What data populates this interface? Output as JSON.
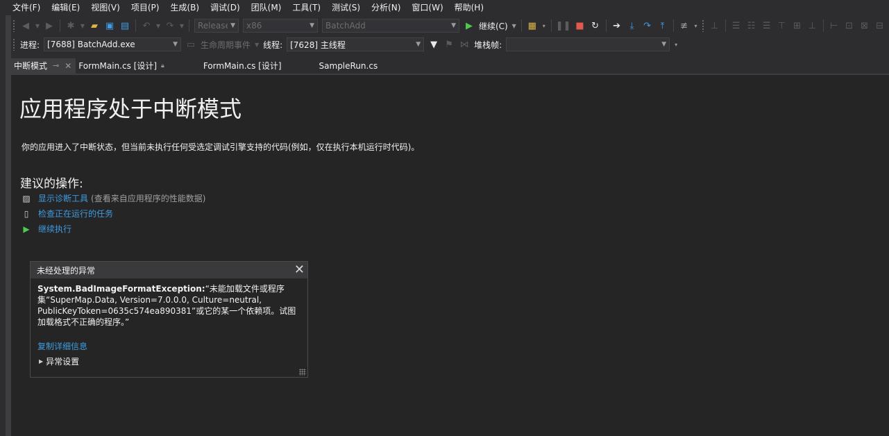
{
  "menu": [
    "文件(F)",
    "编辑(E)",
    "视图(V)",
    "项目(P)",
    "生成(B)",
    "调试(D)",
    "团队(M)",
    "工具(T)",
    "测试(S)",
    "分析(N)",
    "窗口(W)",
    "帮助(H)"
  ],
  "toolbar1": {
    "configuration": "Release",
    "platform": "x86",
    "startup_project": "BatchAdd",
    "continue_label": "继续(C)"
  },
  "toolbar2": {
    "process_label": "进程:",
    "process_value": "[7688] BatchAdd.exe",
    "lifecycle_label": "生命周期事件",
    "thread_label": "线程:",
    "thread_value": "[7628] 主线程",
    "stackframe_label": "堆栈帧:",
    "stackframe_value": ""
  },
  "tabs": [
    {
      "label": "中断模式",
      "active": true
    },
    {
      "label": "FormMain.cs [设计]",
      "active": false
    },
    {
      "label": "FormMain.cs [设计]",
      "active": false
    },
    {
      "label": "SampleRun.cs",
      "active": false
    }
  ],
  "break_page": {
    "title": "应用程序处于中断模式",
    "description": "你的应用进入了中断状态，但当前未执行任何受选定调试引擎支持的代码(例如，仅在执行本机运行时代码)。",
    "actions_title": "建议的操作:",
    "actions": [
      {
        "link": "显示诊断工具",
        "hint": "(查看来自应用程序的性能数据)"
      },
      {
        "link": "检查正在运行的任务",
        "hint": ""
      },
      {
        "link": "继续执行",
        "hint": ""
      }
    ]
  },
  "exception": {
    "title": "未经处理的异常",
    "type": "System.BadImageFormatException:",
    "message": "“未能加载文件或程序集“SuperMap.Data, Version=7.0.0.0, Culture=neutral, PublicKeyToken=0635c574ea890381”或它的某一个依赖项。试图加载格式不正确的程序。”",
    "copy_details": "复制详细信息",
    "settings": "异常设置"
  },
  "colors": {
    "background": "#2d2d30",
    "content": "#252526",
    "link": "#3f9ce0",
    "green": "#4ec94e",
    "red": "#e05a4e"
  }
}
